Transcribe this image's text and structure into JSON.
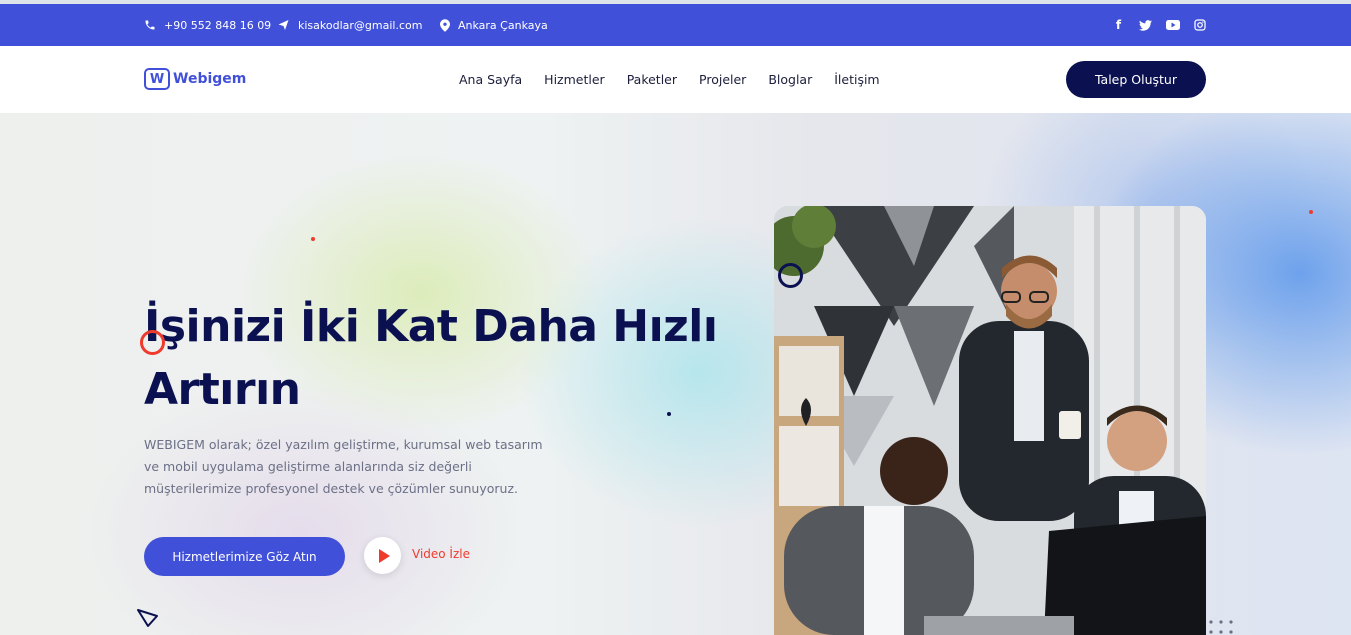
{
  "topbar": {
    "phone": "+90 552 848 16 09",
    "email": "kisakodlar@gmail.com",
    "location": "Ankara Çankaya",
    "icons": [
      "phone-icon",
      "paper-plane-icon",
      "map-pin-icon"
    ],
    "social": [
      "facebook-icon",
      "twitter-icon",
      "youtube-icon",
      "instagram-icon"
    ]
  },
  "logo": {
    "text": "Webigem"
  },
  "nav": {
    "items": [
      "Ana Sayfa",
      "Hizmetler",
      "Paketler",
      "Projeler",
      "Bloglar",
      "İletişim"
    ]
  },
  "header_cta": "Talep Oluştur",
  "hero": {
    "title_line1": "İşinizi İki Kat Daha Hızlı",
    "title_line2": "Artırın",
    "description": "WEBIGEM olarak; özel yazılım geliştirme, kurumsal web tasarım ve mobil uygulama geliştirme alanlarında siz değerli müşterilerimize profesyonel destek ve çözümler sunuyoruz.",
    "primary_button": "Hizmetlerimize Göz Atın",
    "video_label": "Video İzle"
  },
  "colors": {
    "brand_blue": "#4150d8",
    "navy": "#0b1150",
    "accent_red": "#ef3b2c"
  }
}
